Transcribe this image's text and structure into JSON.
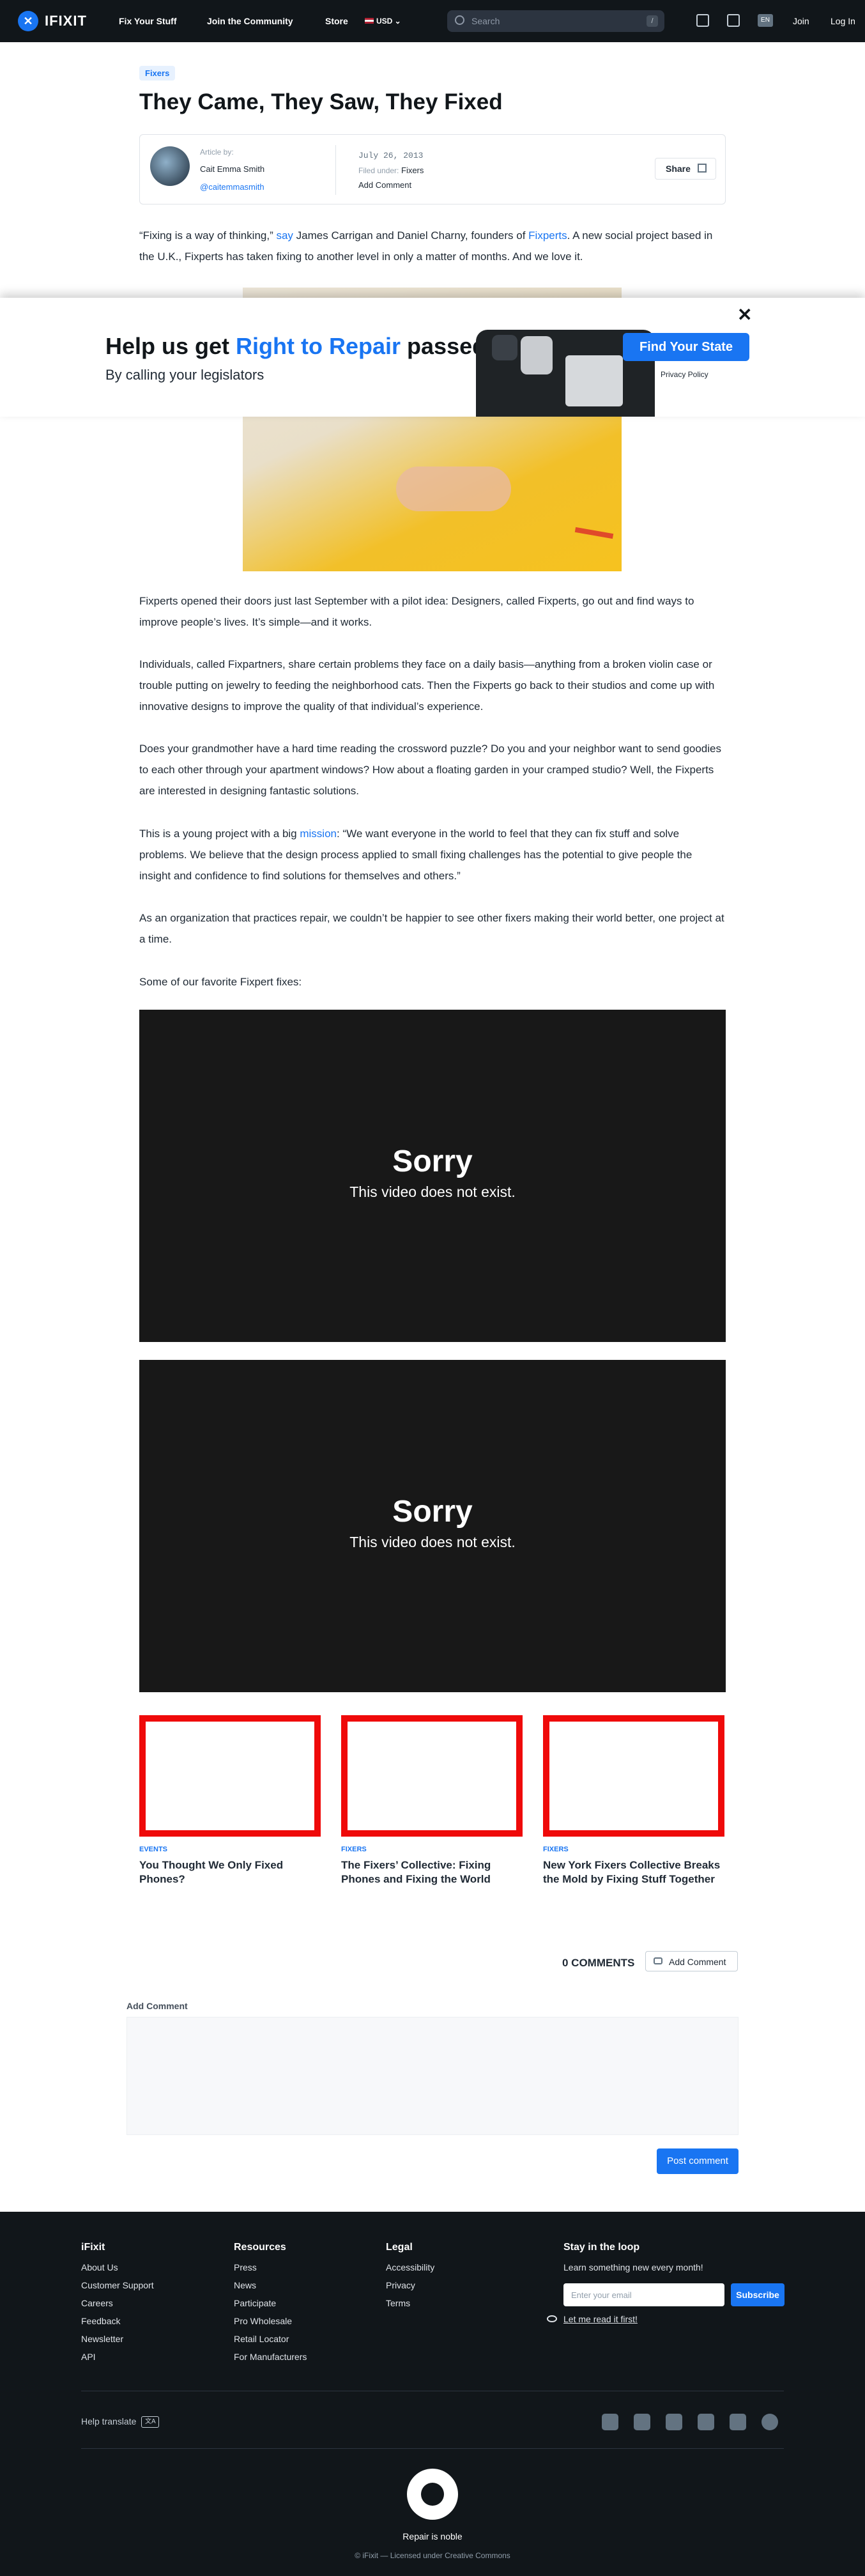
{
  "nav": {
    "brand": "IFIXIT",
    "links": [
      "Fix Your Stuff",
      "Join the Community",
      "Store"
    ],
    "currency": "USD",
    "search_placeholder": "Search",
    "search_shortcut": "/",
    "lang": "EN",
    "join": "Join",
    "login": "Log In"
  },
  "article": {
    "tag": "Fixers",
    "title": "They Came, They Saw, They Fixed",
    "byline": {
      "label": "Article by:",
      "author": "Cait Emma Smith",
      "handle": "@caitemmasmith",
      "date": "July 26, 2013",
      "filed_label": "Filed under:",
      "filed_value": "Fixers",
      "add_comment": "Add Comment",
      "share": "Share"
    },
    "intro": {
      "t1": "“Fixing is a way of thinking,” ",
      "l1": "say",
      "t2": " James Carrigan and Daniel Charny, founders of ",
      "l2": "Fixperts",
      "t3": ". A new social project based in the U.K., Fixperts has taken fixing to another level in only a matter of months. And we love it."
    },
    "p1": "Fixperts opened their doors just last September with a pilot idea: Designers, called Fixperts, go out and find ways to improve people’s lives. It’s simple—and it works.",
    "p2": "Individuals, called Fixpartners, share certain problems they face on a daily basis—anything from a broken violin case or trouble putting on jewelry to feeding the neighborhood cats. Then the Fixperts go back to their studios and come up with innovative designs to improve the quality of that individual’s experience.",
    "p3": "Does your grandmother have a hard time reading the crossword puzzle? Do you and your neighbor want to send goodies to each other through your apartment windows? How about a floating garden in your cramped studio? Well, the Fixperts are interested in designing fantastic solutions.",
    "p4": {
      "t1": "This is a young project with a big ",
      "l1": "mission",
      "t2": ": “We want everyone in the world to feel that they can fix stuff and solve problems. We believe that the design process applied to small fixing challenges has the potential to give people the insight and confidence to find solutions for themselves and others.”"
    },
    "p5": "As an organization that practices repair, we couldn’t be happier to see other fixers making their world better, one project at a time.",
    "p6": "Some of our favorite Fixpert fixes:"
  },
  "banner": {
    "title_a": "Help us get ",
    "title_hl": "Right to Repair",
    "title_b": " passed",
    "subtitle": "By calling your legislators",
    "cta": "Find Your State",
    "privacy": "Privacy Policy",
    "close": "✕"
  },
  "videos": [
    {
      "title": "Sorry",
      "message": "This video does not exist."
    },
    {
      "title": "Sorry",
      "message": "This video does not exist."
    }
  ],
  "related": [
    {
      "category": "EVENTS",
      "title": "You Thought We Only Fixed Phones?"
    },
    {
      "category": "FIXERS",
      "title": "The Fixers’ Collective: Fixing Phones and Fixing the World"
    },
    {
      "category": "FIXERS",
      "title": "New York Fixers Collective Breaks the Mold by Fixing Stuff Together"
    }
  ],
  "comments": {
    "count": "0 COMMENTS",
    "add_button": "Add Comment",
    "form_label": "Add Comment",
    "post": "Post comment"
  },
  "footer": {
    "cols": [
      {
        "heading": "iFixit",
        "items": [
          "About Us",
          "Customer Support",
          "Careers",
          "Feedback",
          "Newsletter",
          "API"
        ]
      },
      {
        "heading": "Resources",
        "items": [
          "Press",
          "News",
          "Participate",
          "Pro Wholesale",
          "Retail Locator",
          "For Manufacturers"
        ]
      },
      {
        "heading": "Legal",
        "items": [
          "Accessibility",
          "Privacy",
          "Terms"
        ]
      }
    ],
    "newsletter": {
      "heading": "Stay in the loop",
      "text": "Learn something new every month!",
      "placeholder": "Enter your email",
      "subscribe": "Subscribe",
      "read": "Let me read it first!"
    },
    "translate": "Help translate",
    "slogan": "Repair is noble",
    "license": "© iFixit — Licensed under Creative Commons"
  }
}
